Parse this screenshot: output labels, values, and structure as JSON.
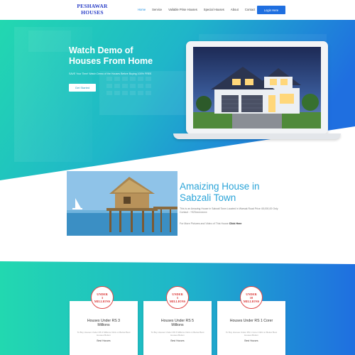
{
  "brand": {
    "logo_line1": "PESHAWAR",
    "logo_line2": "HOUSES"
  },
  "nav": {
    "items": [
      {
        "label": "Home",
        "active": true
      },
      {
        "label": "Service",
        "active": false
      },
      {
        "label": "Vailable Prise Houses",
        "active": false
      },
      {
        "label": "Special Houses",
        "active": false
      },
      {
        "label": "About",
        "active": false
      },
      {
        "label": "Contact",
        "active": false
      }
    ],
    "login_label": "Login Here"
  },
  "hero": {
    "title_line1": "Watch Demo of",
    "title_line2": "Houses From Home",
    "subtitle": "SAVE Your Time! Watch Demo of the Houses Before Buying 100% FREE",
    "button_label": "Get Started"
  },
  "feature": {
    "title_line1": "Amaizing House in",
    "title_line2": "Sabzali Town",
    "description": "This is an Amazing House in Sabzali Town Located in Warsak Road Price 45,000,00 Only Contact : +923xxxxxxxxx",
    "link_text": "For More Pictures and Video of This House ",
    "link_label": "Click Here"
  },
  "cards": [
    {
      "badge": [
        "UNDER",
        "3",
        "MILLIONS"
      ],
      "title_line1": "Houses Under RS 3",
      "title_line2": "Millions",
      "description": "To Buy Houses Under RS 3 Millions Click on Below Best Houses Button",
      "button_label": "Best Houses"
    },
    {
      "badge": [
        "UNDER",
        "5",
        "MILLIONS"
      ],
      "title_line1": "Houses Under RS 5",
      "title_line2": "Millions",
      "description": "To Buy Houses Under RS 5 Millions Click on Below Best Houses Button",
      "button_label": "Best Houses"
    },
    {
      "badge": [
        "UNDER",
        "10",
        "MILLIONS"
      ],
      "title_line1": "Houses Under RS 1 Corer",
      "title_line2": "",
      "description": "To Buy Houses Under RS 1 Corer Click on Below Best Houses Button",
      "button_label": "Best Houses"
    }
  ],
  "colors": {
    "accent": "#1f6fe0",
    "hero_gradient_start": "#20d6b4",
    "hero_gradient_end": "#1f6fe0",
    "badge_red": "#d93030"
  }
}
